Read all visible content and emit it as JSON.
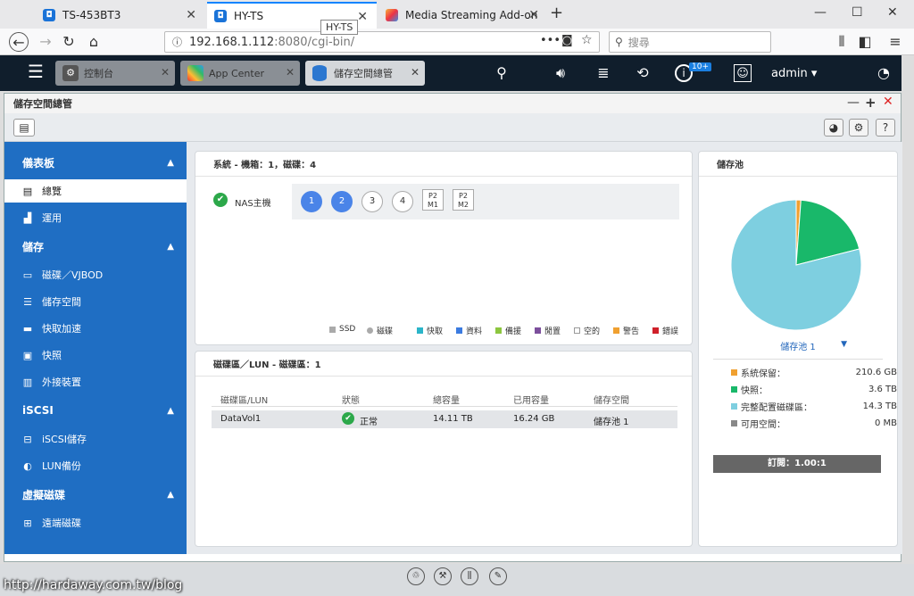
{
  "browser": {
    "tabs": [
      {
        "label": "TS-453BT3"
      },
      {
        "label": "HY-TS"
      },
      {
        "label": "Media Streaming Add-on"
      }
    ],
    "tooltip": "HY-TS",
    "url_host": "192.168.1.112",
    "url_rest": ":8080/cgi-bin/",
    "search_placeholder": "搜尋"
  },
  "qts": {
    "tabs": [
      {
        "label": "控制台"
      },
      {
        "label": "App Center"
      },
      {
        "label": "儲存空間總管"
      }
    ],
    "notification_badge": "10+",
    "user": "admin ▾"
  },
  "app": {
    "title": "儲存空間總管",
    "sidebar": [
      {
        "type": "section",
        "label": "儀表板"
      },
      {
        "type": "item",
        "label": "總覽",
        "icon": "overview-icon",
        "glyph": "▤",
        "active": true
      },
      {
        "type": "item",
        "label": "運用",
        "icon": "chart-icon",
        "glyph": "▟"
      },
      {
        "type": "section",
        "label": "儲存"
      },
      {
        "type": "item",
        "label": "磁碟／VJBOD",
        "icon": "disk-icon",
        "glyph": "▭"
      },
      {
        "type": "item",
        "label": "儲存空間",
        "icon": "stack-icon",
        "glyph": "☰"
      },
      {
        "type": "item",
        "label": "快取加速",
        "icon": "cache-icon",
        "glyph": "▬"
      },
      {
        "type": "item",
        "label": "快照",
        "icon": "snapshot-icon",
        "glyph": "▣"
      },
      {
        "type": "item",
        "label": "外接裝置",
        "icon": "external-device-icon",
        "glyph": "▥"
      },
      {
        "type": "section",
        "label": "iSCSI"
      },
      {
        "type": "item",
        "label": "iSCSI儲存",
        "icon": "iscsi-icon",
        "glyph": "⊟"
      },
      {
        "type": "item",
        "label": "LUN備份",
        "icon": "backup-icon",
        "glyph": "◐"
      },
      {
        "type": "section",
        "label": "虛擬磁碟"
      },
      {
        "type": "item",
        "label": "遠端磁碟",
        "icon": "remote-disk-icon",
        "glyph": "⊞"
      }
    ],
    "system_card": {
      "title": "系統 - 機箱：1，磁碟：4",
      "host_label": "NAS主機",
      "disks": [
        {
          "label": "1",
          "active": true
        },
        {
          "label": "2",
          "active": true
        },
        {
          "label": "3",
          "active": false
        },
        {
          "label": "4",
          "active": false
        }
      ],
      "slots": [
        {
          "l1": "P2",
          "l2": "M1"
        },
        {
          "l1": "P2",
          "l2": "M2"
        }
      ],
      "legend": [
        {
          "label": "SSD",
          "color": "#aaaaaa"
        },
        {
          "label": "磁碟",
          "color": "#aaaaaa",
          "round": true
        },
        {
          "label": "快取",
          "color": "#2bb5c9"
        },
        {
          "label": "資料",
          "color": "#3b7be0"
        },
        {
          "label": "備援",
          "color": "#8cc63f"
        },
        {
          "label": "閒置",
          "color": "#7c4f9c"
        },
        {
          "label": "空的",
          "color": "#ffffff"
        },
        {
          "label": "警告",
          "color": "#f0a030"
        },
        {
          "label": "錯誤",
          "color": "#d0202a"
        }
      ]
    },
    "volume_card": {
      "title": "磁碟區／LUN - 磁碟區：1",
      "headers": [
        "磁碟區/LUN",
        "狀態",
        "總容量",
        "已用容量",
        "儲存空間"
      ],
      "rows": [
        {
          "name": "DataVol1",
          "status": "正常",
          "total": "14.11 TB",
          "used": "16.24 GB",
          "pool": "儲存池 1"
        }
      ]
    },
    "pool_card": {
      "title": "儲存池",
      "selected_pool": "儲存池 1",
      "legend": [
        {
          "label": "系統保留：",
          "value": "210.6 GB",
          "color": "#f0a030"
        },
        {
          "label": "快照：",
          "value": "3.6 TB",
          "color": "#19b86a"
        },
        {
          "label": "完整配置磁碟區：",
          "value": "14.3 TB",
          "color": "#7ecfe0"
        },
        {
          "label": "可用空間：",
          "value": "0 MB",
          "color": "#888888"
        }
      ],
      "subscription": "訂閱：1.00:1"
    },
    "chart_data": {
      "type": "pie",
      "categories": [
        "系統保留",
        "快照",
        "完整配置磁碟區",
        "可用空間"
      ],
      "values": [
        0.21,
        3.6,
        14.3,
        0
      ],
      "colors": [
        "#f0a030",
        "#19b86a",
        "#7ecfe0",
        "#888888"
      ]
    }
  },
  "watermark": "http://hardaway.com.tw/blog"
}
